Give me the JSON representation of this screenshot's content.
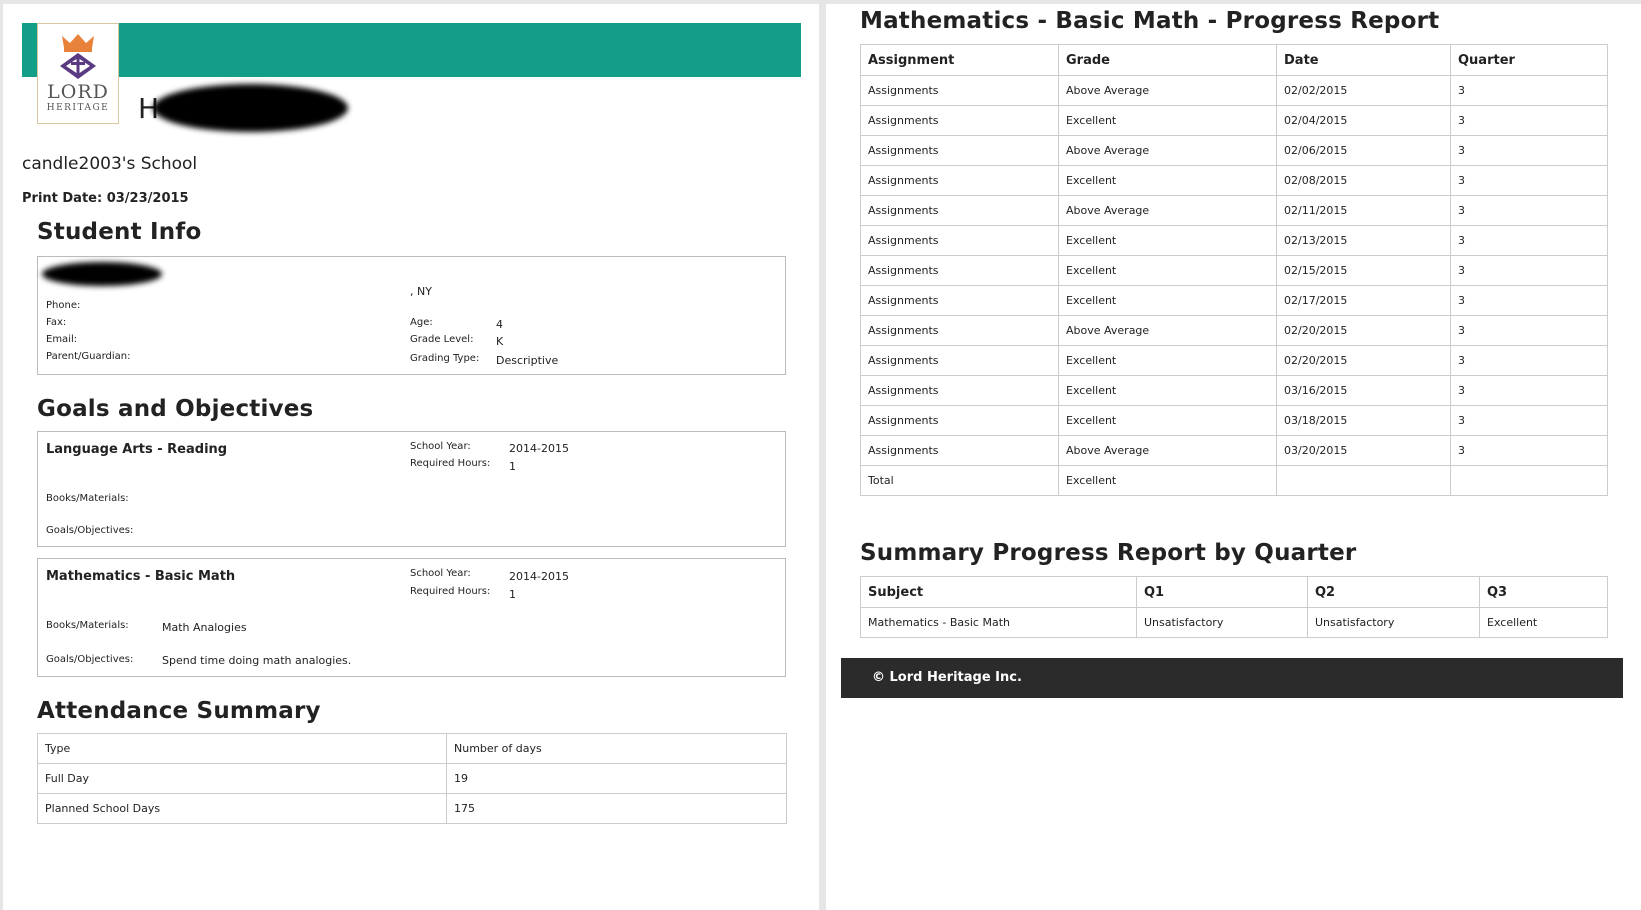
{
  "header": {
    "logo_text": "LORD",
    "logo_subtext": "HERITAGE",
    "student_name_prefix": "H",
    "school_name": "candle2003's School",
    "print_date_label": "Print Date:",
    "print_date": "03/23/2015"
  },
  "student_info": {
    "title": "Student Info",
    "city_state": ", NY",
    "phone_label": "Phone:",
    "fax_label": "Fax:",
    "email_label": "Email:",
    "parent_label": "Parent/Guardian:",
    "age_label": "Age:",
    "age": "4",
    "grade_level_label": "Grade Level:",
    "grade_level": "K",
    "grading_type_label": "Grading Type:",
    "grading_type": "Descriptive"
  },
  "goals": {
    "title": "Goals and Objectives",
    "items": [
      {
        "subject": "Language Arts - Reading",
        "school_year_label": "School Year:",
        "school_year": "2014-2015",
        "required_hours_label": "Required Hours:",
        "required_hours": "1",
        "books_label": "Books/Materials:",
        "books": "",
        "objectives_label": "Goals/Objectives:",
        "objectives": ""
      },
      {
        "subject": "Mathematics - Basic Math",
        "school_year_label": "School Year:",
        "school_year": "2014-2015",
        "required_hours_label": "Required Hours:",
        "required_hours": "1",
        "books_label": "Books/Materials:",
        "books": "Math Analogies",
        "objectives_label": "Goals/Objectives:",
        "objectives": "Spend time doing math analogies."
      }
    ]
  },
  "attendance": {
    "title": "Attendance Summary",
    "headers": [
      "Type",
      "Number of days"
    ],
    "rows": [
      [
        "Full Day",
        "19"
      ],
      [
        "Planned School Days",
        "175"
      ]
    ]
  },
  "progress_report": {
    "title": "Mathematics - Basic Math - Progress Report",
    "headers": [
      "Assignment",
      "Grade",
      "Date",
      "Quarter"
    ],
    "rows": [
      [
        "Assignments",
        "Above Average",
        "02/02/2015",
        "3"
      ],
      [
        "Assignments",
        "Excellent",
        "02/04/2015",
        "3"
      ],
      [
        "Assignments",
        "Above Average",
        "02/06/2015",
        "3"
      ],
      [
        "Assignments",
        "Excellent",
        "02/08/2015",
        "3"
      ],
      [
        "Assignments",
        "Above Average",
        "02/11/2015",
        "3"
      ],
      [
        "Assignments",
        "Excellent",
        "02/13/2015",
        "3"
      ],
      [
        "Assignments",
        "Excellent",
        "02/15/2015",
        "3"
      ],
      [
        "Assignments",
        "Excellent",
        "02/17/2015",
        "3"
      ],
      [
        "Assignments",
        "Above Average",
        "02/20/2015",
        "3"
      ],
      [
        "Assignments",
        "Excellent",
        "02/20/2015",
        "3"
      ],
      [
        "Assignments",
        "Excellent",
        "03/16/2015",
        "3"
      ],
      [
        "Assignments",
        "Excellent",
        "03/18/2015",
        "3"
      ],
      [
        "Assignments",
        "Above Average",
        "03/20/2015",
        "3"
      ],
      [
        "Total",
        "Excellent",
        "",
        ""
      ]
    ]
  },
  "summary": {
    "title": "Summary Progress Report by Quarter",
    "headers": [
      "Subject",
      "Q1",
      "Q2",
      "Q3"
    ],
    "rows": [
      [
        "Mathematics - Basic Math",
        "Unsatisfactory",
        "Unsatisfactory",
        "Excellent"
      ]
    ]
  },
  "footer": {
    "text": "© Lord Heritage Inc."
  },
  "colors": {
    "banner": "#129e87",
    "footer": "#2b2b2b",
    "logo_orange": "#e8823a",
    "logo_purple": "#5a3a82"
  }
}
